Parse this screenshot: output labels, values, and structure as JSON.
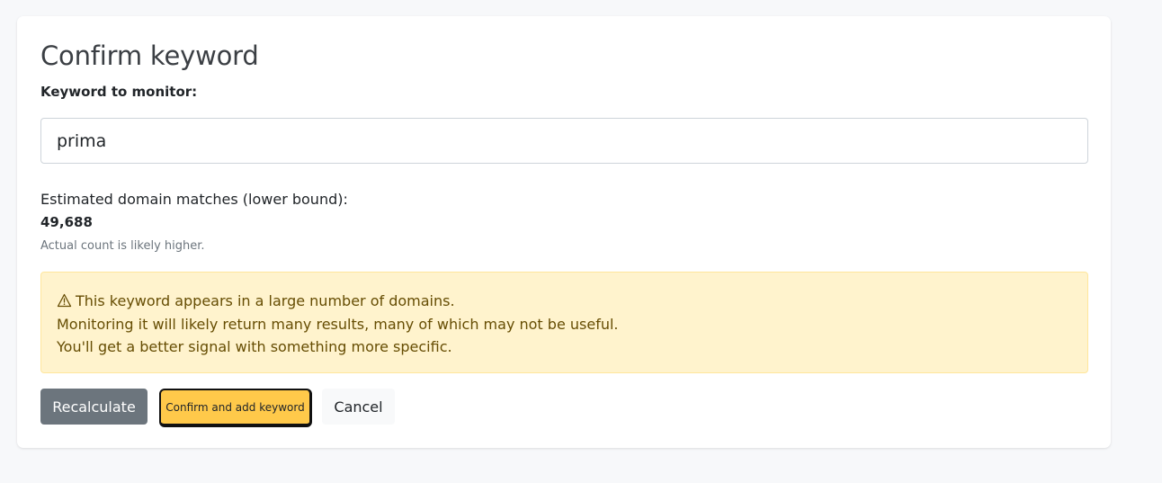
{
  "card": {
    "title": "Confirm keyword",
    "field_label": "Keyword to monitor:",
    "keyword_value": "prima"
  },
  "estimate": {
    "label": "Estimated domain matches (lower bound):",
    "value": "49,688",
    "note": "Actual count is likely higher."
  },
  "warning": {
    "icon": "warning-triangle-icon",
    "line1": "This keyword appears in a large number of domains.",
    "line2": "Monitoring it will likely return many results, many of which may not be useful.",
    "line3": "You'll get a better signal with something more specific."
  },
  "actions": {
    "recalculate_label": "Recalculate",
    "confirm_label": "Confirm and add keyword",
    "cancel_label": "Cancel"
  },
  "colors": {
    "warning_bg": "#fff3cd",
    "warning_text": "#664d03",
    "confirm_bg": "#ffc94a",
    "secondary_bg": "#6c757d"
  }
}
